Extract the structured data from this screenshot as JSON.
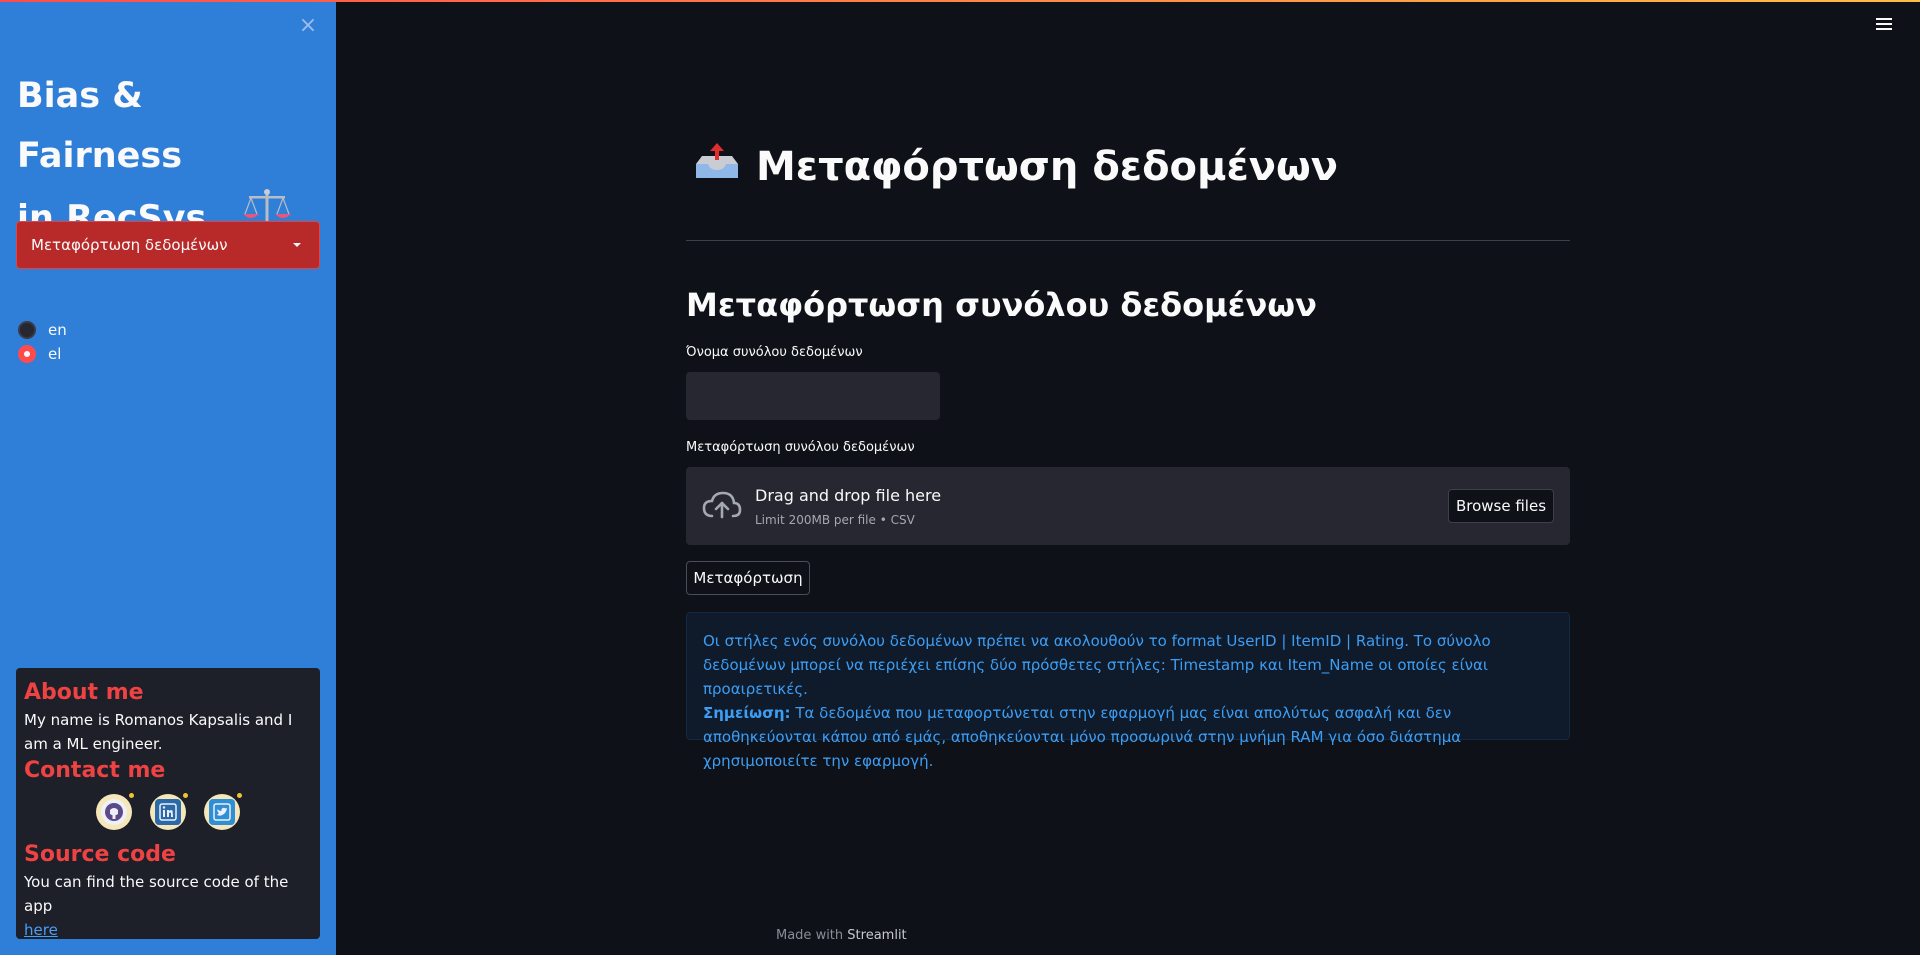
{
  "sidebar": {
    "title_line1": "Bias & Fairness",
    "title_line2": "in RecSys",
    "title_icon": "balance-scale-icon",
    "page_select": {
      "selected": "Μεταφόρτωση δεδομένων"
    },
    "language_options": [
      {
        "label": "en",
        "checked": false
      },
      {
        "label": "el",
        "checked": true
      }
    ],
    "about": {
      "about_heading": "About me",
      "about_text": "My name is Romanos Kapsalis and I am a ML engineer.",
      "contact_heading": "Contact me",
      "social_icons": [
        "github-icon",
        "linkedin-icon",
        "twitter-icon"
      ],
      "source_heading": "Source code",
      "source_text": "You can find the source code of the app",
      "source_link": "here"
    }
  },
  "main": {
    "page_title": "Μεταφόρτωση δεδομένων",
    "page_title_icon": "inbox-upload-icon",
    "section_title": "Μεταφόρτωση συνόλου δεδομένων",
    "name_label": "Όνομα συνόλου δεδομένων",
    "name_value": "",
    "upload_label": "Μεταφόρτωση συνόλου δεδομένων",
    "dropzone": {
      "title": "Drag and drop file here",
      "limit": "Limit 200MB per file • CSV",
      "browse_label": "Browse files"
    },
    "upload_button": "Μεταφόρτωση",
    "info": {
      "line1": "Οι στήλες ενός συνόλου δεδομένων πρέπει να ακολουθούν το format UserID | ItemID | Rating. Το σύνολο δεδομένων μπορεί να περιέχει επίσης δύο πρόσθετες στήλες: Timestamp και Item_Name οι οποίες είναι προαιρετικές.",
      "note_label": "Σημείωση:",
      "note_text": " Τα δεδομένα που μεταφορτώνεται στην εφαρμογή μας είναι απολύτως ασφαλή και δεν αποθηκεύονται κάπου από εμάς, αποθηκεύονται μόνο προσωρινά στην μνήμη RAM για όσο διάστημα χρησιμοποιείτε την εφαρμογή."
    }
  },
  "footer": {
    "prefix": "Made with",
    "brand": "Streamlit"
  },
  "colors": {
    "background": "#0e1117",
    "sidebar": "#2f7fd9",
    "accent": "#ff4b4b",
    "info_text": "#3d9df3"
  }
}
